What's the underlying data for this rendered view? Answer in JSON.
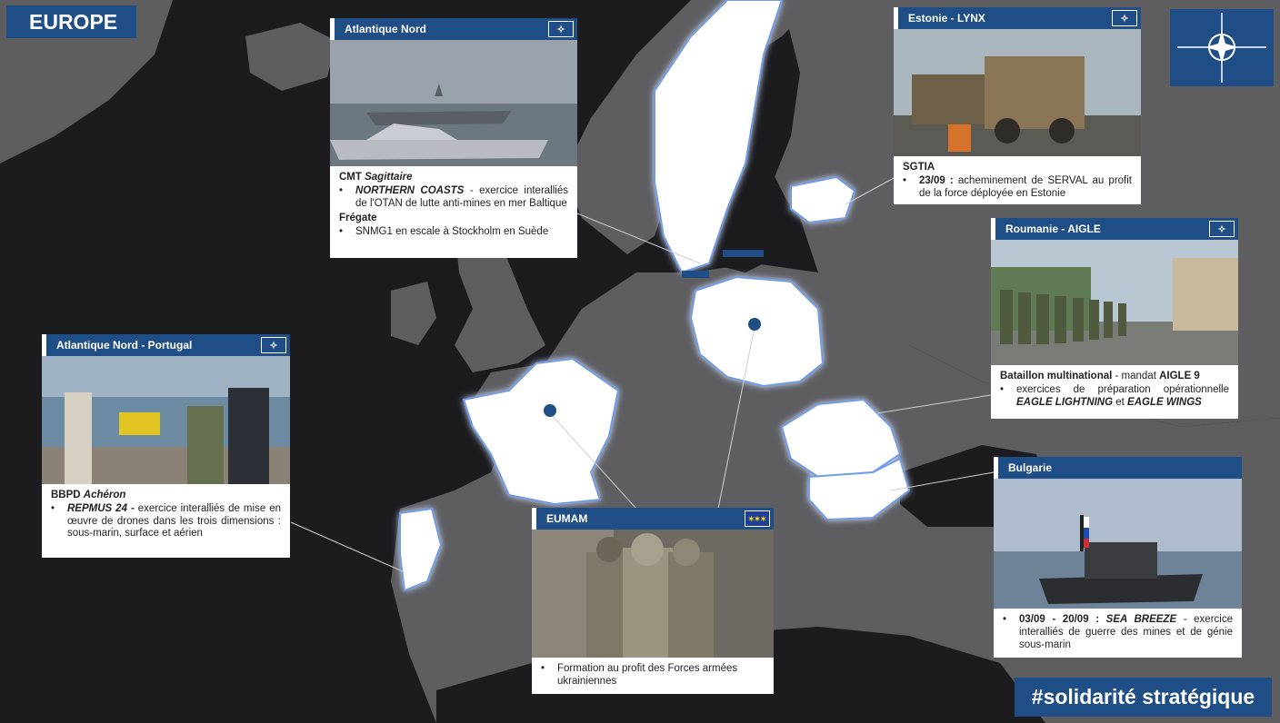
{
  "title": "EUROPE",
  "hashtag": "#solidarité stratégique",
  "colors": {
    "nato_blue": "#1f4e86",
    "map_land": "#5e5e60",
    "map_sea": "#1c1c1e",
    "highlight": "#ffffff",
    "glow": "#4a7bd4"
  },
  "flag_icon": "nato-star-icon",
  "cards": {
    "atlantique_nord": {
      "header": "Atlantique Nord",
      "badge_icon": "nato-icon",
      "photo": "naval-vessels-at-sea",
      "section1_title_a": "CMT ",
      "section1_title_b": "Sagittaire",
      "bullet1_bold": "NORTHERN COASTS",
      "bullet1_text": " - exercice interalliés de l'OTAN de lutte anti-mines en mer Baltique",
      "section2_title": "Frégate",
      "bullet2_text": "SNMG1 en escale à Stockholm en Suède"
    },
    "estonie": {
      "header": "Estonie - LYNX",
      "badge_icon": "nato-icon",
      "photo": "armored-vehicles",
      "section_title": "SGTIA",
      "bullet_bold": "23/09 :",
      "bullet_text": " acheminement de SERVAL au profit de la force déployée en Estonie"
    },
    "roumanie": {
      "header": "Roumanie - AIGLE",
      "badge_icon": "nato-icon",
      "photo": "military-ceremony",
      "section_title_bold": "Bataillon multinational",
      "section_title_text": "  - mandat ",
      "section_title_bold2": "AIGLE 9",
      "bullet_text": "exercices de préparation opérationnelle ",
      "bullet_bold1": "EAGLE LIGHTNING",
      "bullet_mid": " et ",
      "bullet_bold2": "EAGLE WINGS"
    },
    "portugal": {
      "header": "Atlantique Nord - Portugal",
      "badge_icon": "nato-icon",
      "photo": "drone-team-on-boat",
      "section_title_a": "BBPD ",
      "section_title_b": "Achéron",
      "bullet_bold": "REPMUS 24 -",
      "bullet_text": " exercice interalliés de mise en œuvre de drones dans les trois dimensions : sous-marin, surface et aérien"
    },
    "eumam": {
      "header": "EUMAM",
      "badge_icon": "eu-flag-icon",
      "photo": "soldiers-training",
      "bullet_text": "Formation au profit des Forces armées ukrainiennes"
    },
    "bulgarie": {
      "header": "Bulgarie",
      "photo": "patrol-boat",
      "bullet_bold": "03/09 - 20/09 :",
      "bullet_bold_i": " SEA BREEZE",
      "bullet_text": " - exercice interalliés de guerre des mines et de génie sous-marin"
    }
  }
}
